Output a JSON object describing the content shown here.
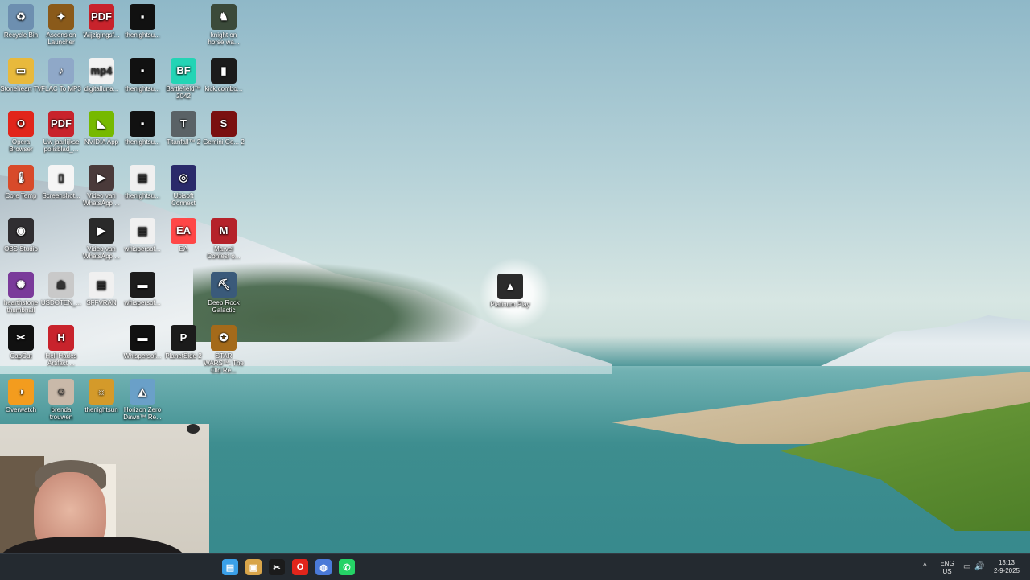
{
  "desktop": {
    "icons": [
      {
        "label": "Recycle Bin",
        "glyph": "♻",
        "color": "#6d8fb0"
      },
      {
        "label": "Ascension Launcher",
        "glyph": "✦",
        "color": "#8a5a1a"
      },
      {
        "label": "Wijzigingsf...",
        "glyph": "PDF",
        "color": "#c8232c"
      },
      {
        "label": "thenightsu...",
        "glyph": "▪",
        "color": "#111111"
      },
      {
        "label": "knight on horse wa...",
        "glyph": "♞",
        "color": "#3b4a3a"
      },
      {
        "label": "Stoneheart TV",
        "glyph": "▭",
        "color": "#e8b93c"
      },
      {
        "label": "FLAC To MP3",
        "glyph": "♪",
        "color": "#8fa8c8"
      },
      {
        "label": "digitalluna...",
        "glyph": "mp4",
        "color": "#f2f2f2"
      },
      {
        "label": "thenightsu...",
        "glyph": "▪",
        "color": "#111111"
      },
      {
        "label": "Battlefield™ 2042",
        "glyph": "BF",
        "color": "#23d4b5"
      },
      {
        "label": "kick.combo...",
        "glyph": "▮",
        "color": "#1b1b1b"
      },
      {
        "label": "Opera Browser",
        "glyph": "O",
        "color": "#e1251b"
      },
      {
        "label": "Uw jaarlijkse polisblad_...",
        "glyph": "PDF",
        "color": "#c8232c"
      },
      {
        "label": "NVIDIA App",
        "glyph": "◣",
        "color": "#76b900"
      },
      {
        "label": "thenightsu...",
        "glyph": "▪",
        "color": "#111111"
      },
      {
        "label": "Titanfall™ 2",
        "glyph": "T",
        "color": "#5a6266"
      },
      {
        "label": "Gemini Ge... 2",
        "glyph": "S",
        "color": "#7a1010"
      },
      {
        "label": "Core Temp",
        "glyph": "🌡",
        "color": "#d84a2a"
      },
      {
        "label": "Screenshot...",
        "glyph": "▯",
        "color": "#f5f5f5"
      },
      {
        "label": "Video van WhatsApp ...",
        "glyph": "▶",
        "color": "#4a3a3a"
      },
      {
        "label": "thenightsu...",
        "glyph": "▤",
        "color": "#f0f0f0"
      },
      {
        "label": "Ubisoft Connect",
        "glyph": "◎",
        "color": "#2a2a6a"
      },
      {
        "label": "OBS Studio",
        "glyph": "◉",
        "color": "#302e31"
      },
      {
        "label": "Video van WhatsApp ...",
        "glyph": "▶",
        "color": "#2a2a2a"
      },
      {
        "label": "whispersof...",
        "glyph": "▤",
        "color": "#f0f0f0"
      },
      {
        "label": "EA",
        "glyph": "EA",
        "color": "#ff4747"
      },
      {
        "label": "Marvel Contest o...",
        "glyph": "M",
        "color": "#b5222a"
      },
      {
        "label": "hearthstone thumbnail",
        "glyph": "✺",
        "color": "#7a3a9a"
      },
      {
        "label": "USDOTEN_...",
        "glyph": "☗",
        "color": "#c9c9c9"
      },
      {
        "label": "SFFVRAN",
        "glyph": "▤",
        "color": "#f0f0f0"
      },
      {
        "label": "whispersof...",
        "glyph": "▬",
        "color": "#1d1d1d"
      },
      {
        "label": "Deep Rock Galactic",
        "glyph": "⛏",
        "color": "#3a5a7a"
      },
      {
        "label": "CapCut",
        "glyph": "✂",
        "color": "#111111"
      },
      {
        "label": "Hell Hades Artifact ...",
        "glyph": "H",
        "color": "#c8232c"
      },
      {
        "label": "Whispersof...",
        "glyph": "▬",
        "color": "#111111"
      },
      {
        "label": "PlanetSide 2",
        "glyph": "P",
        "color": "#1b1b1b"
      },
      {
        "label": "STAR WARS™: The Old Re...",
        "glyph": "✪",
        "color": "#a46a1a"
      },
      {
        "label": "Overwatch",
        "glyph": "◑",
        "color": "#f39c1e"
      },
      {
        "label": "brenda trouwen",
        "glyph": "☺",
        "color": "#c9b9a9"
      },
      {
        "label": "thenightsun",
        "glyph": "☼",
        "color": "#d49a2a"
      },
      {
        "label": "Horizon Zero Dawn™ Re...",
        "glyph": "◭",
        "color": "#6aa0c8"
      },
      {
        "label": "Platinum Play",
        "glyph": "▲",
        "color": "#2b2b2b"
      }
    ]
  },
  "taskbar": {
    "items": [
      {
        "name": "notepad-icon",
        "glyph": "▤",
        "color": "#3aa0e8"
      },
      {
        "name": "explorer-icon",
        "glyph": "▣",
        "color": "#d8a54a"
      },
      {
        "name": "capcut-icon",
        "glyph": "✂",
        "color": "#1b1b1b"
      },
      {
        "name": "opera-icon",
        "glyph": "O",
        "color": "#e1251b"
      },
      {
        "name": "app-icon",
        "glyph": "◍",
        "color": "#4a7ad8"
      },
      {
        "name": "whatsapp-icon",
        "glyph": "✆",
        "color": "#25d366"
      }
    ],
    "tray": {
      "chevron": "^",
      "lang_top": "ENG",
      "lang_bottom": "US",
      "network": "▭",
      "volume": "🔊",
      "time": "13:13",
      "date": "2-9-2025"
    }
  }
}
